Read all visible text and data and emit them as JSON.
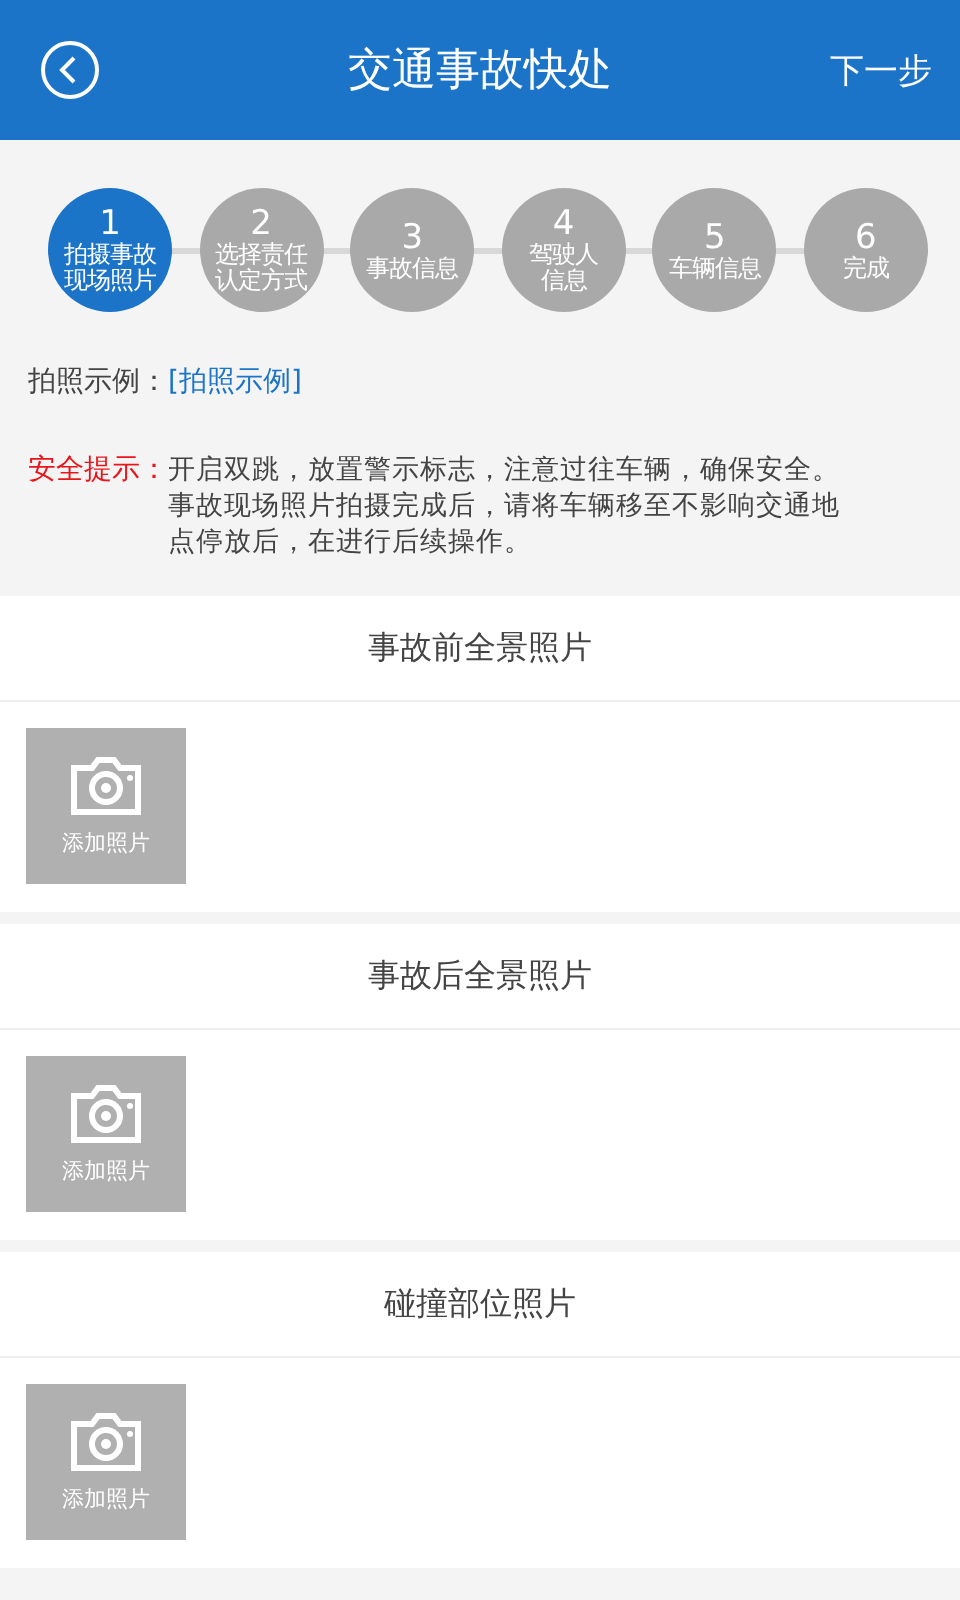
{
  "header": {
    "title": "交通事故快处",
    "next": "下一步"
  },
  "steps": [
    {
      "number": "1",
      "label_lines": [
        "拍摄事故",
        "现场照片"
      ],
      "selected": true
    },
    {
      "number": "2",
      "label_lines": [
        "选择责任",
        "认定方式"
      ],
      "selected": false
    },
    {
      "number": "3",
      "label_lines": [
        "事故信息"
      ],
      "selected": false
    },
    {
      "number": "4",
      "label_lines": [
        "驾驶人",
        "信息"
      ],
      "selected": false
    },
    {
      "number": "5",
      "label_lines": [
        "车辆信息"
      ],
      "selected": false
    },
    {
      "number": "6",
      "label_lines": [
        "完成"
      ],
      "selected": false
    }
  ],
  "example": {
    "label": "拍照示例：",
    "link": "[拍照示例]"
  },
  "safety": {
    "label": "安全提示：",
    "paragraphs": [
      "开启双跳，放置警示标志，注意过往车辆，确保安全。",
      "事故现场照片拍摄完成后，请将车辆移至不影响交通地点停放后，在进行后续操作。"
    ]
  },
  "sections": [
    {
      "title": "事故前全景照片",
      "add_label": "添加照片"
    },
    {
      "title": "事故后全景照片",
      "add_label": "添加照片"
    },
    {
      "title": "碰撞部位照片",
      "add_label": "添加照片"
    }
  ]
}
